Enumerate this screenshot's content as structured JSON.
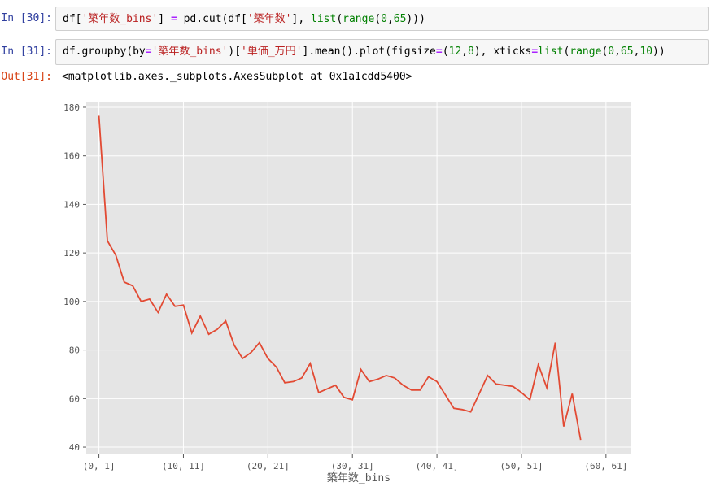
{
  "cells": [
    {
      "prompt": "In [30]:",
      "code": [
        {
          "t": "df[",
          "c": ""
        },
        {
          "t": "'築年数_bins'",
          "c": "str"
        },
        {
          "t": "] ",
          "c": ""
        },
        {
          "t": "=",
          "c": "op"
        },
        {
          "t": " pd.cut(df[",
          "c": ""
        },
        {
          "t": "'築年数'",
          "c": "str"
        },
        {
          "t": "], ",
          "c": ""
        },
        {
          "t": "list",
          "c": "kw"
        },
        {
          "t": "(",
          "c": ""
        },
        {
          "t": "range",
          "c": "kw"
        },
        {
          "t": "(",
          "c": ""
        },
        {
          "t": "0",
          "c": "num"
        },
        {
          "t": ",",
          "c": ""
        },
        {
          "t": "65",
          "c": "num"
        },
        {
          "t": ")))",
          "c": ""
        }
      ]
    },
    {
      "prompt": "In [31]:",
      "code": [
        {
          "t": "df.groupby(by",
          "c": ""
        },
        {
          "t": "=",
          "c": "op"
        },
        {
          "t": "'築年数_bins'",
          "c": "str"
        },
        {
          "t": ")[",
          "c": ""
        },
        {
          "t": "'単価_万円'",
          "c": "str"
        },
        {
          "t": "].mean().plot(figsize",
          "c": ""
        },
        {
          "t": "=",
          "c": "op"
        },
        {
          "t": "(",
          "c": ""
        },
        {
          "t": "12",
          "c": "num"
        },
        {
          "t": ",",
          "c": ""
        },
        {
          "t": "8",
          "c": "num"
        },
        {
          "t": "), xticks",
          "c": ""
        },
        {
          "t": "=",
          "c": "op"
        },
        {
          "t": "list",
          "c": "kw"
        },
        {
          "t": "(",
          "c": ""
        },
        {
          "t": "range",
          "c": "kw"
        },
        {
          "t": "(",
          "c": ""
        },
        {
          "t": "0",
          "c": "num"
        },
        {
          "t": ",",
          "c": ""
        },
        {
          "t": "65",
          "c": "num"
        },
        {
          "t": ",",
          "c": ""
        },
        {
          "t": "10",
          "c": "num"
        },
        {
          "t": "))",
          "c": ""
        }
      ]
    }
  ],
  "output": {
    "prompt": "Out[31]:",
    "text": "<matplotlib.axes._subplots.AxesSubplot at 0x1a1cdd5400>"
  },
  "colors": {
    "axes_bg": "#e5e5e5",
    "grid": "#ffffff",
    "line": "#e24a33",
    "tick_text": "#555555"
  },
  "chart_data": {
    "type": "line",
    "title": "",
    "xlabel": "築年数_bins",
    "ylabel": "",
    "xlim": [
      -1.5,
      63
    ],
    "ylim": [
      37,
      182
    ],
    "grid": true,
    "xtick_positions": [
      0,
      10,
      20,
      30,
      40,
      50,
      60
    ],
    "xtick_labels": [
      "(0, 1]",
      "(10, 11]",
      "(20, 21]",
      "(30, 31]",
      "(40, 41]",
      "(50, 51]",
      "(60, 61]"
    ],
    "yticks": [
      40,
      60,
      80,
      100,
      120,
      140,
      160,
      180
    ],
    "series": [
      {
        "x": [
          0,
          1,
          2,
          3,
          4,
          5,
          6,
          7,
          8,
          9,
          10,
          11,
          12,
          13,
          14,
          15,
          16,
          17,
          18,
          19,
          20,
          21,
          22,
          23,
          24,
          25,
          26,
          27,
          28,
          29,
          30,
          31,
          32,
          33,
          34,
          35,
          36,
          37,
          38,
          39,
          40,
          41,
          42,
          43,
          44,
          45,
          46,
          47,
          48,
          49,
          50,
          51,
          52,
          53,
          54,
          55,
          56,
          57
        ],
        "values": [
          176.5,
          125,
          119,
          108,
          106.5,
          100,
          101,
          95.5,
          103,
          98,
          98.5,
          87,
          94,
          86.5,
          88.5,
          92,
          82,
          76.5,
          79,
          83,
          76.5,
          73,
          66.5,
          67,
          68.5,
          74.5,
          62.5,
          64,
          65.5,
          60.5,
          59.5,
          72,
          67,
          68,
          69.5,
          68.5,
          65.5,
          63.5,
          63.5,
          69,
          67,
          61.5,
          56,
          55.5,
          54.5,
          62,
          69.5,
          66,
          65.5,
          65,
          62.5,
          59.5,
          74,
          64.5,
          83,
          48.5,
          62,
          43
        ]
      }
    ]
  }
}
